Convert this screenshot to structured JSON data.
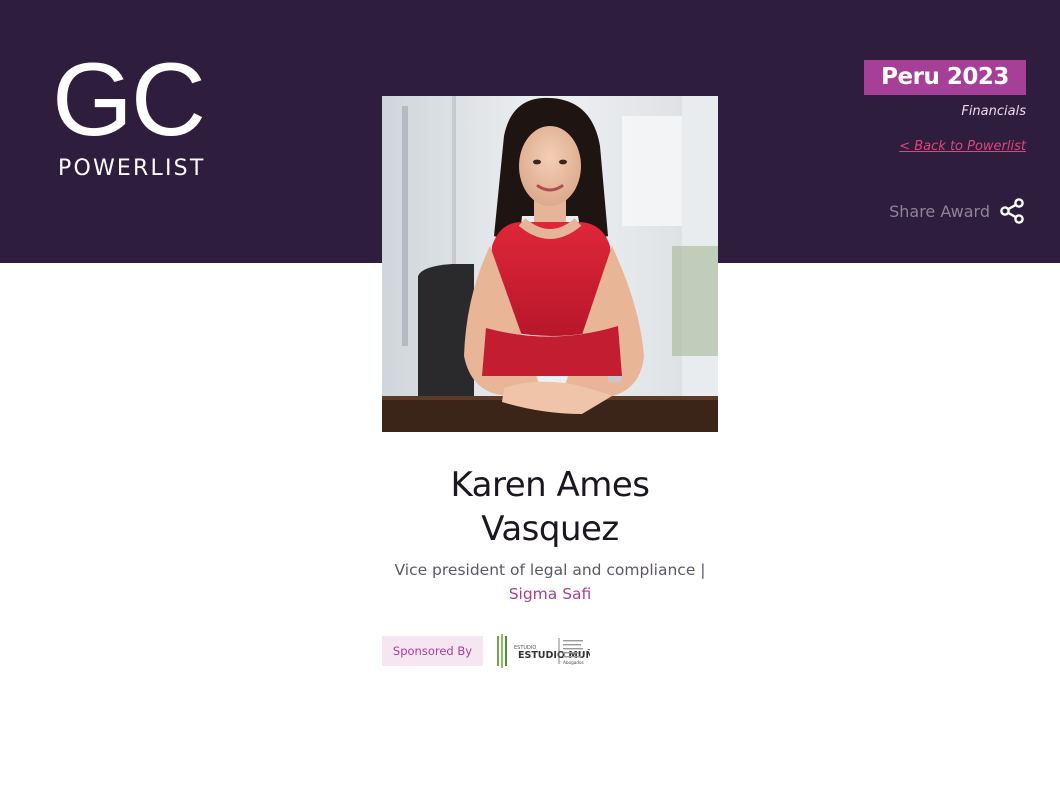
{
  "header": {
    "logo": {
      "primary": "GC",
      "secondary": "POWERLIST"
    },
    "year_badge": "Peru 2023",
    "category": "Financials",
    "back_link": "< Back to Powerlist",
    "share_label": "Share Award",
    "share_icon": "share-icon"
  },
  "profile": {
    "name": "Karen Ames Vasquez",
    "title": "Vice president of legal and compliance |",
    "company": "Sigma Safi",
    "photo": "portrait-photo"
  },
  "sponsor": {
    "label": "Sponsored By",
    "logo_name": "ESTUDIO MUÑIZ",
    "logo_small_text": "Abogados"
  },
  "colors": {
    "header_bg": "#2e1d3c",
    "accent": "#a63f98",
    "link": "#e0457f"
  }
}
